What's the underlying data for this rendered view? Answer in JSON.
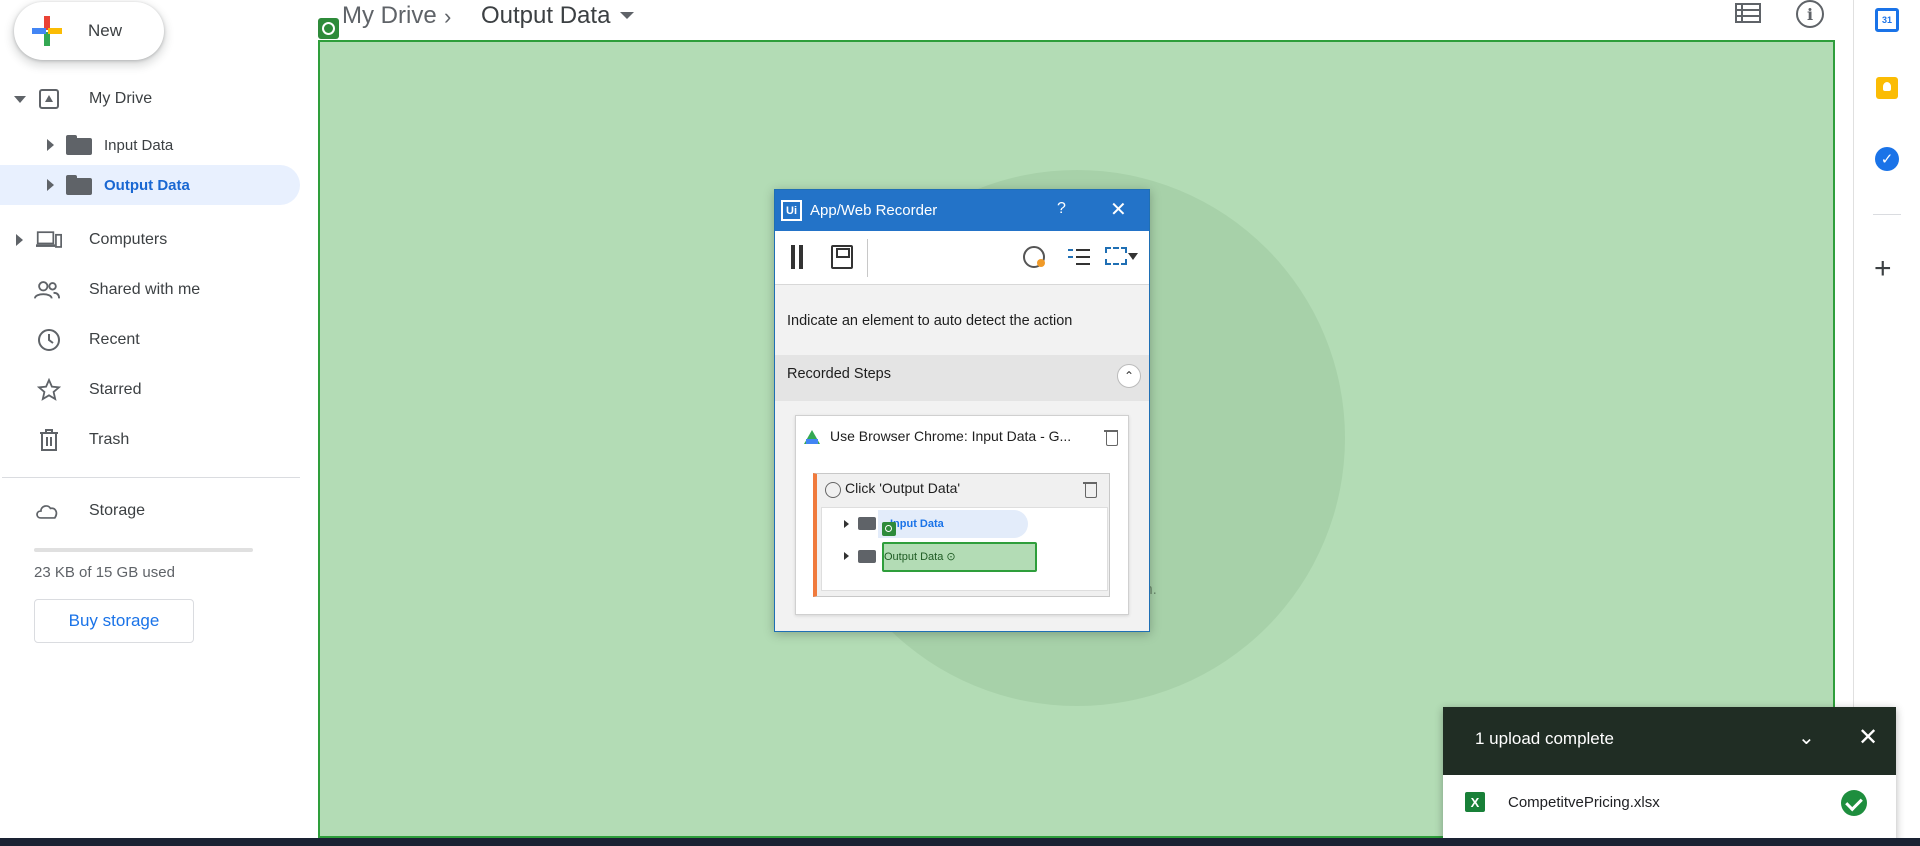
{
  "sidebar": {
    "new_label": "New",
    "nav": {
      "my_drive": "My Drive",
      "input_data": "Input Data",
      "output_data": "Output Data",
      "computers": "Computers",
      "shared": "Shared with me",
      "recent": "Recent",
      "starred": "Starred",
      "trash": "Trash",
      "storage": "Storage"
    },
    "storage_used": "23 KB of 15 GB used",
    "storage_fraction": 0.0,
    "buy_storage": "Buy storage"
  },
  "header": {
    "breadcrumb_root": "My Drive",
    "breadcrumb_sep": "›",
    "breadcrumb_current": "Output Data"
  },
  "side_panel": {
    "calendar_day": "31",
    "add_addon": "+"
  },
  "main": {
    "background_text_fragment": "on."
  },
  "recorder": {
    "title": "App/Web Recorder",
    "logo": "Ui",
    "help": "?",
    "close": "✕",
    "instruction": "Indicate an element to auto detect the action",
    "steps_title": "Recorded Steps",
    "collapse_glyph": "⌃",
    "browser_step": "Use Browser Chrome: Input Data - G...",
    "click_step": "Click 'Output Data'",
    "preview": {
      "input_label": "Input Data",
      "output_label": "Output Data ⊙"
    }
  },
  "upload": {
    "title": "1 upload complete",
    "collapse_glyph": "⌄",
    "close_glyph": "✕",
    "file_icon": "X",
    "file_name": "CompetitvePricing.xlsx"
  },
  "colors": {
    "overlay_green": "#b3dcb5",
    "overlay_border": "#2e9e3b",
    "recorder_blue": "#2373c8",
    "drive_blue": "#1a73e8",
    "toast_header": "#202d24"
  }
}
